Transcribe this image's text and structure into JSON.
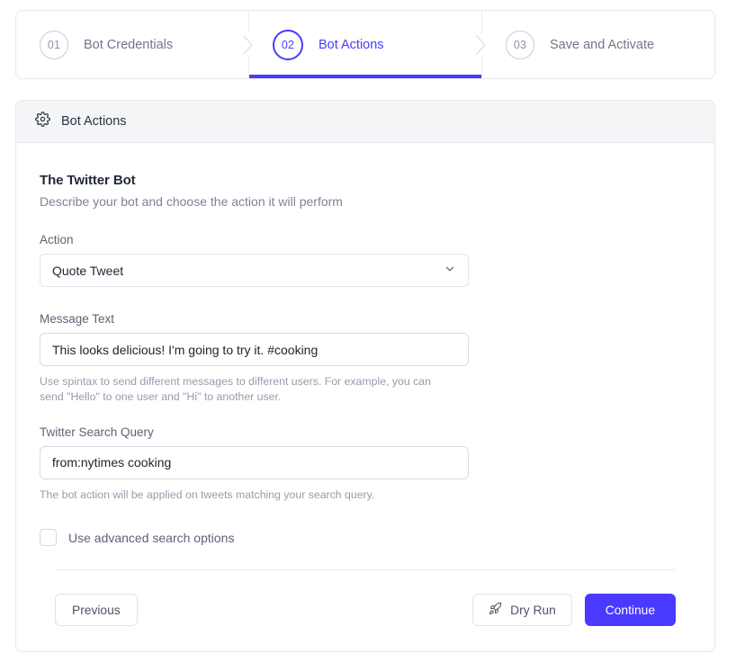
{
  "stepper": {
    "steps": [
      {
        "number": "01",
        "label": "Bot Credentials",
        "active": false
      },
      {
        "number": "02",
        "label": "Bot Actions",
        "active": true
      },
      {
        "number": "03",
        "label": "Save and Activate",
        "active": false
      }
    ]
  },
  "panel": {
    "header_icon": "gear-icon",
    "header_title": "Bot Actions",
    "form": {
      "title": "The Twitter Bot",
      "subtitle": "Describe your bot and choose the action it will perform",
      "action": {
        "label": "Action",
        "value": "Quote Tweet",
        "icon": "chevron-down-icon"
      },
      "message_text": {
        "label": "Message Text",
        "value": "This looks delicious! I'm going to try it. #cooking",
        "help": "Use spintax to send different messages to different users. For example, you can send \"Hello\" to one user and \"Hi\" to another user."
      },
      "search_query": {
        "label": "Twitter Search Query",
        "value": "from:nytimes cooking",
        "help": "The bot action will be applied on tweets matching your search query."
      },
      "advanced": {
        "label": "Use advanced search options",
        "checked": false
      }
    },
    "footer": {
      "previous_label": "Previous",
      "dry_run_label": "Dry Run",
      "dry_run_icon": "rocket-icon",
      "continue_label": "Continue"
    }
  },
  "colors": {
    "accent": "#4a3aff",
    "header_bg": "#f4f5f7",
    "border": "#e7e8ec",
    "muted_text": "#7c8397"
  }
}
